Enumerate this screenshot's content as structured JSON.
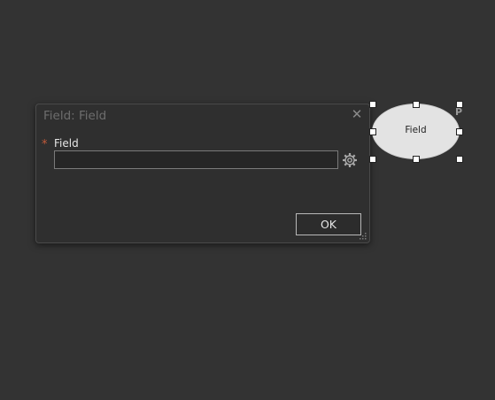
{
  "dialog": {
    "title": "Field: Field",
    "close_icon": "close-icon",
    "field_label": "Field",
    "required_marker": "*",
    "field_value": "",
    "settings_icon": "gear-icon",
    "ok_label": "OK"
  },
  "node": {
    "label": "Field",
    "badge": "P",
    "shape": "ellipse"
  },
  "colors": {
    "background": "#333333",
    "dialog_background": "#2f2f2f",
    "required_marker": "#c25a3a",
    "node_fill": "#e3e3e3"
  }
}
